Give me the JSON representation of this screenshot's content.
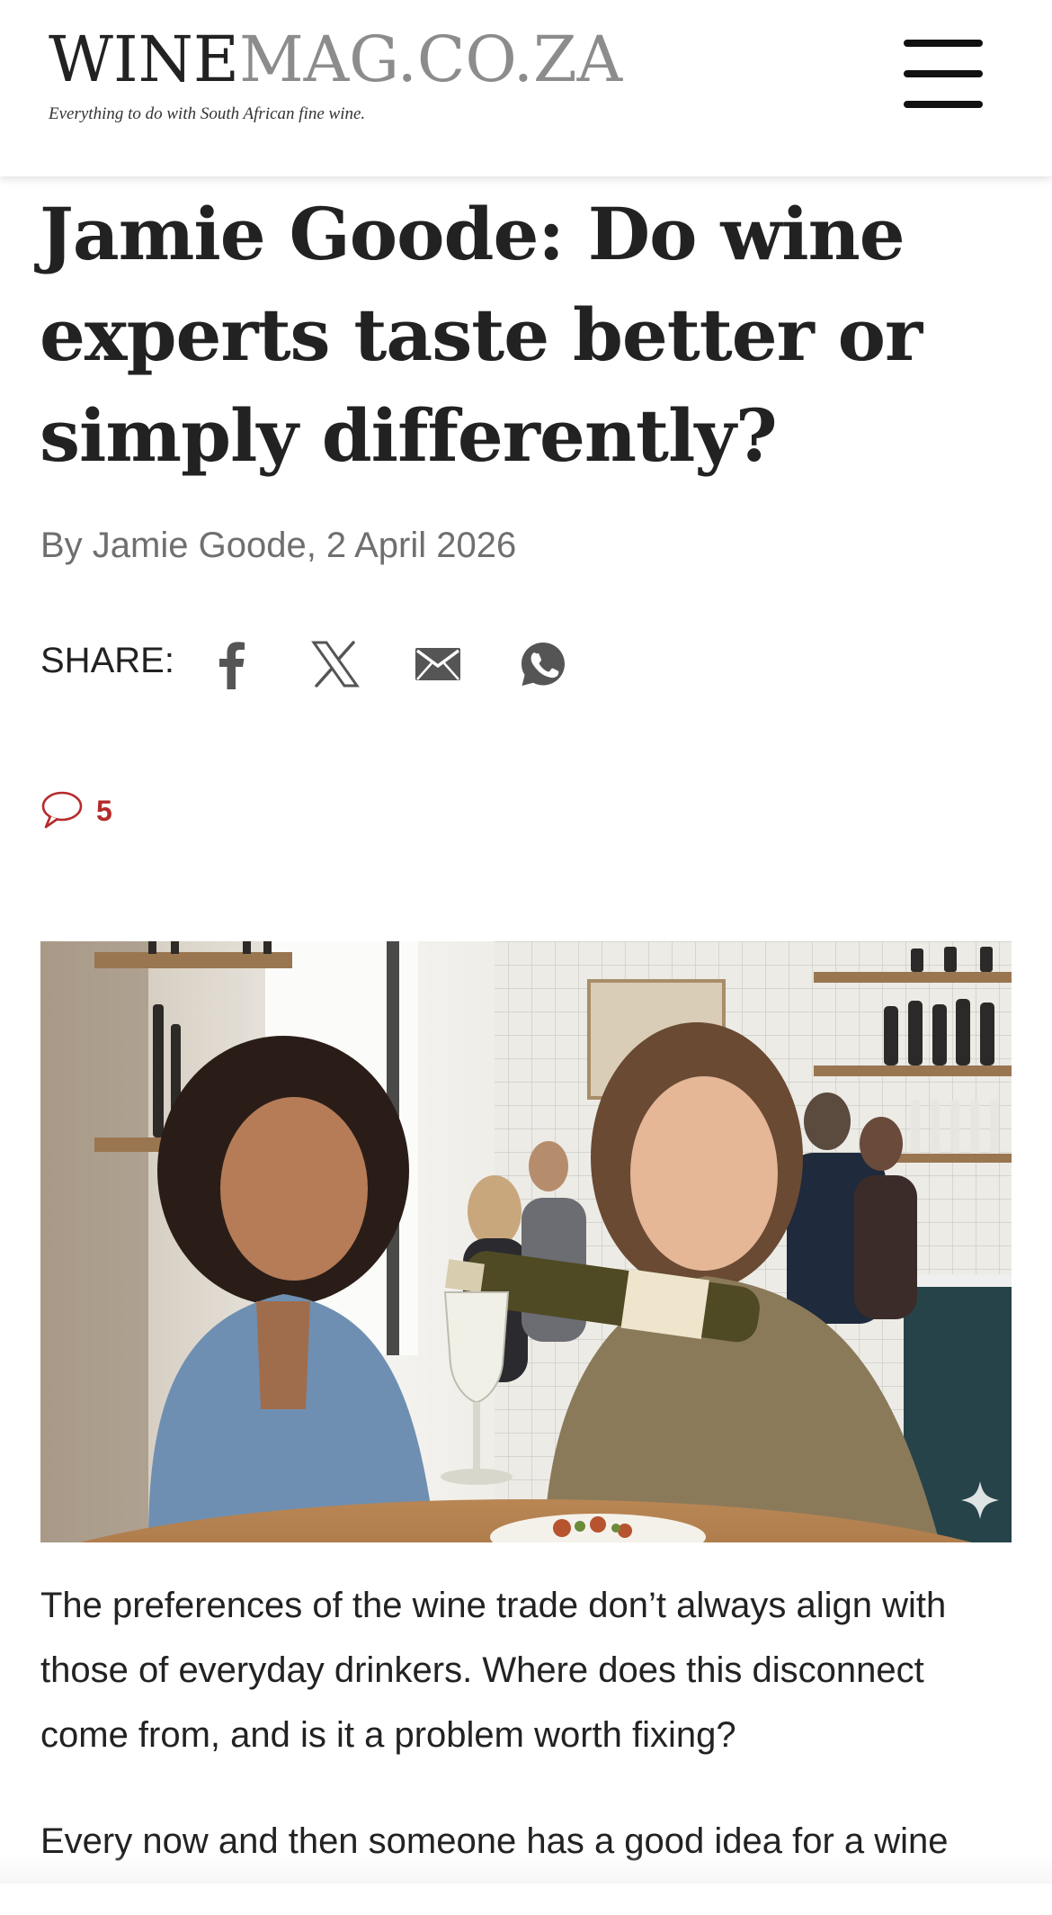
{
  "header": {
    "logo_dark": "WINE",
    "logo_light": "MAG.CO.ZA",
    "tagline": "Everything to do with South African fine wine.",
    "menu_icon": "hamburger-menu-icon"
  },
  "article": {
    "title": "Jamie Goode: Do wine experts taste better or simply differently?",
    "byline": "By Jamie Goode, 2 April 2026",
    "share": {
      "label": "SHARE:",
      "icons": [
        "facebook-icon",
        "x-icon",
        "email-icon",
        "whatsapp-icon"
      ]
    },
    "comments": {
      "icon": "comment-bubble-icon",
      "count": "5"
    },
    "hero_image_icon": "sparkle-icon",
    "paragraphs": [
      "The preferences of the wine trade don’t always align with those of everyday drinkers. Where does this disconnect come from, and is it a problem worth fixing?",
      "Every now and then someone has a good idea for a wine"
    ]
  },
  "colors": {
    "text": "#222222",
    "logo_grey": "#8c8c8c",
    "byline_grey": "#6f6f6f",
    "icon_grey": "#555555",
    "comment_red": "#b52b2b"
  }
}
